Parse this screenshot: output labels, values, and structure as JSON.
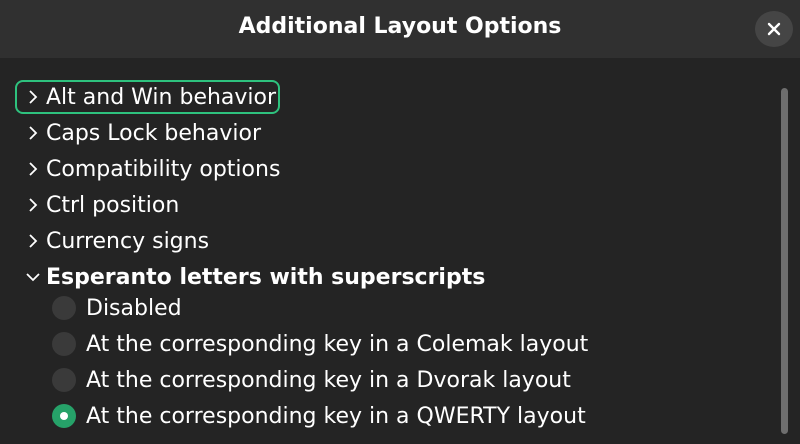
{
  "window": {
    "title": "Additional Layout Options"
  },
  "tree": {
    "categories": [
      {
        "label": "Alt and Win behavior",
        "expanded": false,
        "focused": true
      },
      {
        "label": "Caps Lock behavior",
        "expanded": false
      },
      {
        "label": "Compatibility options",
        "expanded": false
      },
      {
        "label": "Ctrl position",
        "expanded": false
      },
      {
        "label": "Currency signs",
        "expanded": false
      },
      {
        "label": "Esperanto letters with superscripts",
        "expanded": true,
        "options": [
          {
            "label": "Disabled",
            "selected": false
          },
          {
            "label": "At the corresponding key in a Colemak layout",
            "selected": false
          },
          {
            "label": "At the corresponding key in a Dvorak layout",
            "selected": false
          },
          {
            "label": "At the corresponding key in a QWERTY layout",
            "selected": true
          }
        ]
      }
    ]
  },
  "icons": {
    "close": "close-icon",
    "collapsed": "chevron-right-icon",
    "expanded": "chevron-down-icon"
  },
  "colors": {
    "accent": "#2ec27e",
    "selected_radio": "#26a269",
    "background": "#242424",
    "header": "#303030"
  }
}
